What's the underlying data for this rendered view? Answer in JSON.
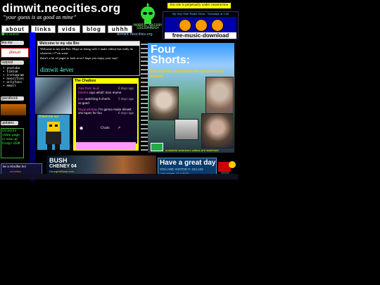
{
  "header": {
    "logo": "dimwit.neocities.org",
    "tagline": "“your guess is as good as mine”",
    "nav": [
      "about",
      "links",
      "vids",
      "blog",
      "uhhh"
    ],
    "alien_caption": "PARENTAL ADVISORY SCHIZOPHRENIA",
    "construction": "this site is perpetually under construction",
    "radio_title": "My Very Own Radio Show - Tuesdays at 1:00",
    "radio_download": "free-music-download",
    "site_url": "dimwit.neocities.org"
  },
  "sidebar": {
    "online": "☻ is online",
    "like_me": "like me",
    "stamp": "dimwit",
    "outpost_label": "outpost",
    "outpost_items": [
      "• youtube",
      "• tiktok",
      "• instagram",
      "• neocities",
      "• onlyfans",
      "• email"
    ],
    "guestbook": "guestbook",
    "updates_label": "updates",
    "updates": [
      "01/20/23",
      "video page",
      "in new up",
      "Firstp! VEM"
    ]
  },
  "welcome": {
    "title": "Welcome to my site Bro",
    "line1": "Welcome to my site Bro. Hope ur doing well. I make videos but really do whatever i f*cm want.",
    "line2": "there's a lot of pages to look at so I hope you enjoy your stay!",
    "sign": "dimwit 4ever"
  },
  "checkout": {
    "label": "Check me out"
  },
  "chatbox": {
    "title": "The Chatbox",
    "messages": [
      {
        "user": "max from louis",
        "text": "",
        "time": "6 days ago"
      },
      {
        "user": "hmmm",
        "text": "says what! man mame",
        "time": ""
      },
      {
        "user": "juan",
        "text": "watching 4 shorts",
        "time": "5 days ago"
      },
      {
        "user": "",
        "text": "so good",
        "time": ""
      },
      {
        "user": "freyaustinbop",
        "text": "I'm gonna make dimwit vhs tapes for fun",
        "time": "6 days ago"
      }
    ],
    "chats_label": "Chats"
  },
  "shorts": {
    "title_line1": "Four",
    "title_line2": "Shorts:",
    "subtitle": "the newest collection of movies from dimwit",
    "footer": "available wherever videos are watched!"
  },
  "bottom": {
    "ad1_text": "be a Hbrdlke bo!",
    "ad1_sub": "neocities",
    "bush_title": "BUSH",
    "bush_sub": "CHENEY 04",
    "bush_url": "GeorgeWBush.com",
    "greatday": "Have a great day",
    "visitor": "YOU ARE VISITOR #: 154,102",
    "date": "Last update: 12.4.2023"
  },
  "colors": {
    "nav_bg": "#ffffff",
    "chat_bg": "#ffff00",
    "accent": "#0033ff"
  }
}
